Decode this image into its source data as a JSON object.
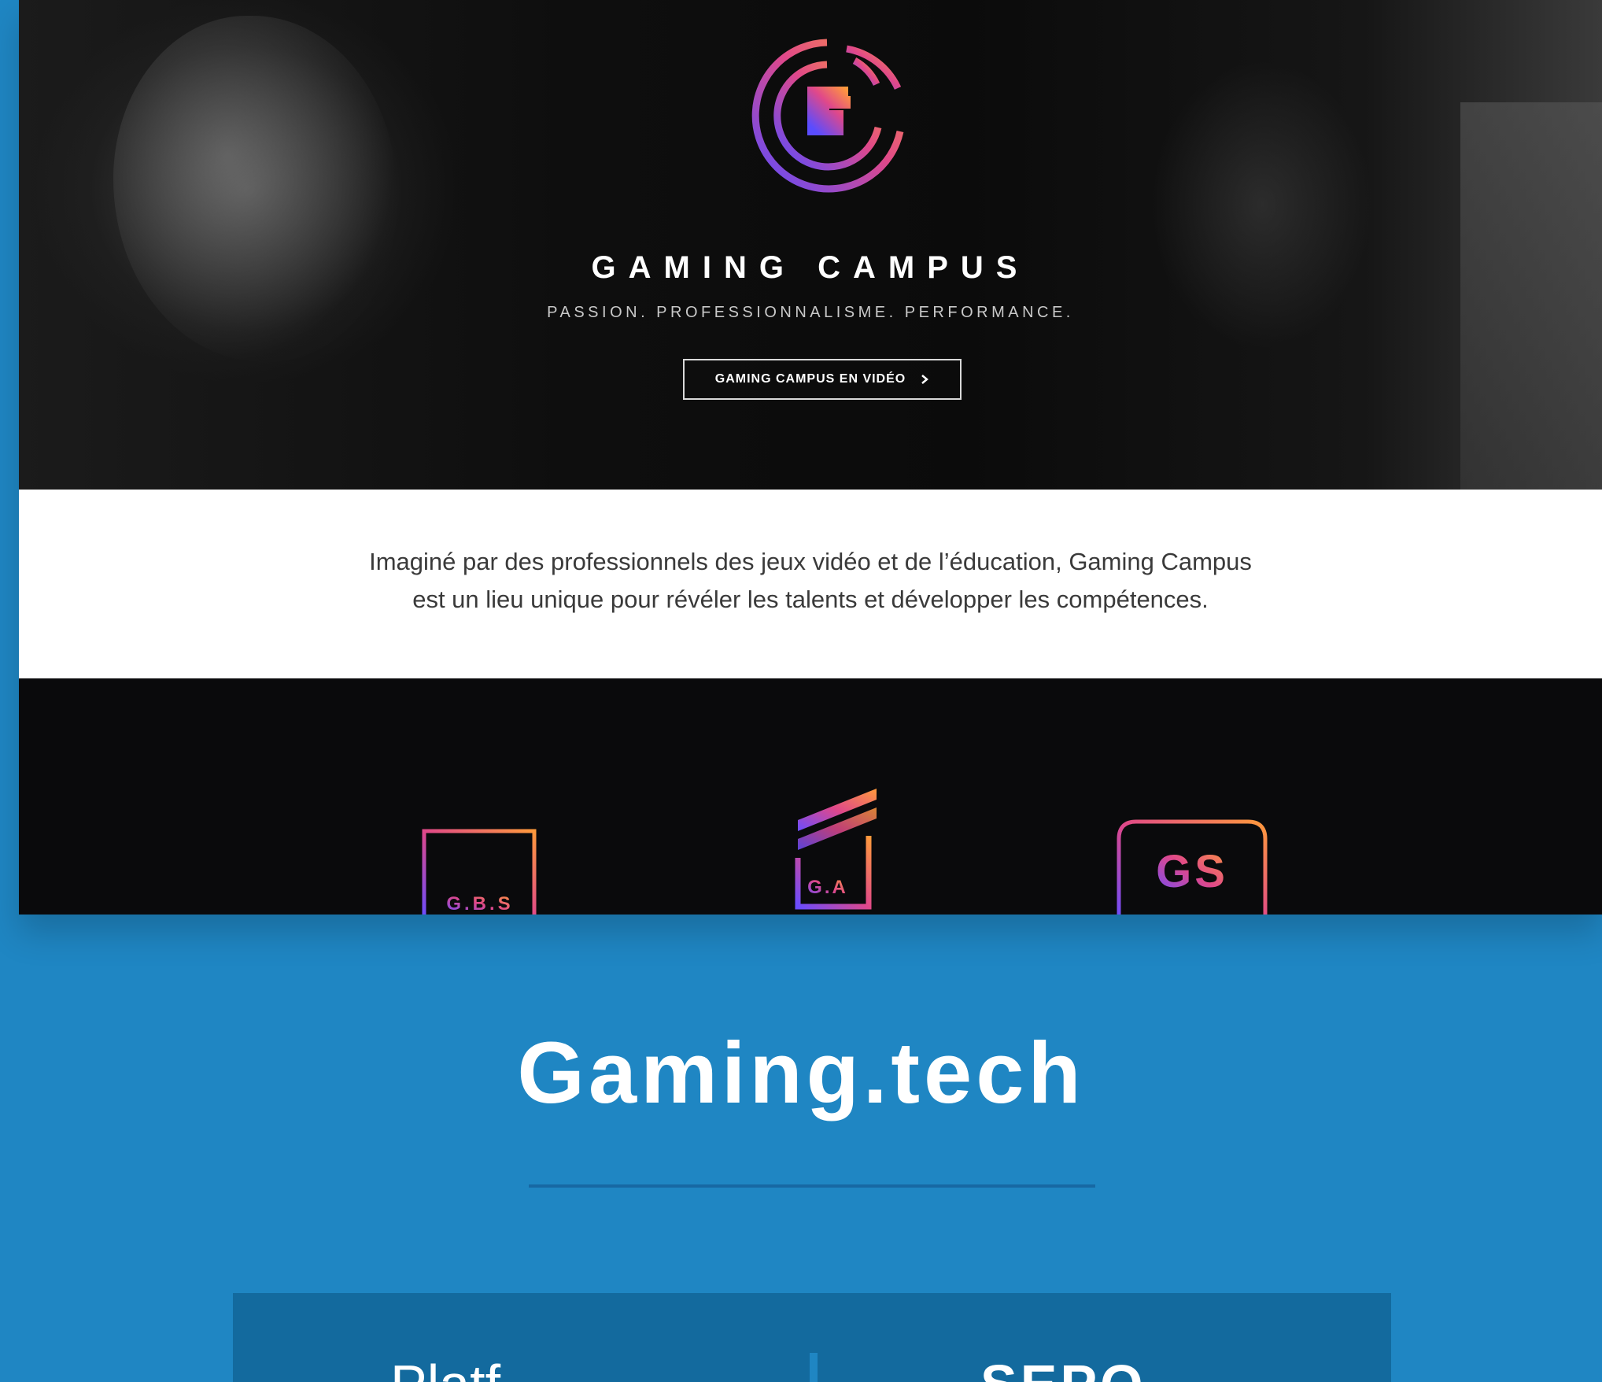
{
  "hero": {
    "brand_title": "GAMING CAMPUS",
    "tagline": "PASSION. PROFESSIONNALISME. PERFORMANCE.",
    "video_button_label": "GAMING CAMPUS EN VIDÉO",
    "video_button_icon": "chevron-right-icon"
  },
  "intro": {
    "line1": "Imaginé par des professionnels des jeux vidéo et de l’éducation, Gaming Campus",
    "line2": "est un lieu unique pour révéler les talents et développer les compétences."
  },
  "schools": {
    "gbs_label": "G.B.S",
    "ga_label": "G.A",
    "gs_label": "GS"
  },
  "page": {
    "title": "Gaming.tech",
    "info_left": "Platf",
    "info_right": "SEPO"
  },
  "colors": {
    "background_blue": "#1f86c3",
    "info_box_blue": "#136a9e",
    "gradient_start": "#6a4cff",
    "gradient_mid": "#e0488a",
    "gradient_end": "#ff9a3c"
  }
}
